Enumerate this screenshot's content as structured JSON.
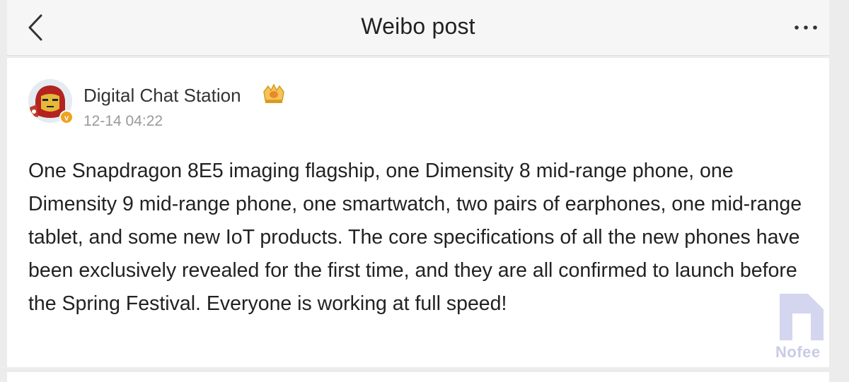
{
  "header": {
    "title": "Weibo post",
    "back_icon": "chevron-left-icon",
    "more_icon": "more-horizontal-icon"
  },
  "post": {
    "author_name": "Digital Chat Station",
    "author_badge_icon": "crown-badge-icon",
    "verified_icon": "verified-badge-icon",
    "timestamp": "12-14 04:22",
    "text": "One Snapdragon 8E5 imaging flagship, one Dimensity 8 mid-range phone, one Dimensity 9 mid-range phone, one smartwatch, two pairs of earphones, one mid-range tablet, and some new IoT products. The core specifications of all the new phones have been exclusively revealed for the first time, and they are all confirmed to launch before the Spring Festival. Everyone is working at full speed!"
  },
  "watermark": {
    "text": "Nofee"
  },
  "colors": {
    "header_bg": "#f6f6f6",
    "page_bg": "#ececec",
    "verified_orange": "#f0a21f",
    "watermark": "#c9cbe6"
  }
}
